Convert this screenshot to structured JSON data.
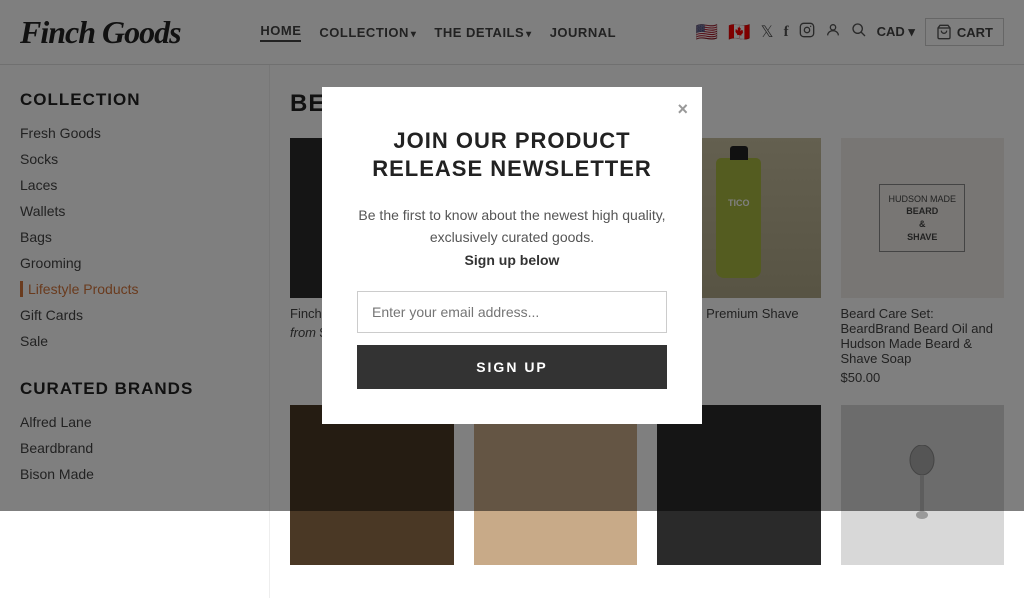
{
  "header": {
    "logo": "Finch Goods",
    "nav": [
      {
        "label": "HOME",
        "active": true,
        "hasDropdown": false
      },
      {
        "label": "COLLECTION",
        "active": false,
        "hasDropdown": true
      },
      {
        "label": "THE DETAILS",
        "active": false,
        "hasDropdown": true
      },
      {
        "label": "JOURNAL",
        "active": false,
        "hasDropdown": false
      }
    ],
    "icons": {
      "usa_flag": "🇺🇸",
      "canada_flag": "🇨🇦",
      "twitter": "𝕏",
      "facebook": "f",
      "instagram": "📷",
      "user": "👤",
      "search": "🔍"
    },
    "cad_label": "CAD ▾",
    "cart_label": "CART"
  },
  "sidebar": {
    "collection_title": "COLLECTION",
    "collection_items": [
      {
        "label": "Fresh Goods",
        "active": false
      },
      {
        "label": "Socks",
        "active": false
      },
      {
        "label": "Laces",
        "active": false
      },
      {
        "label": "Wallets",
        "active": false
      },
      {
        "label": "Bags",
        "active": false
      },
      {
        "label": "Grooming",
        "active": false
      },
      {
        "label": "Lifestyle Products",
        "active": true
      },
      {
        "label": "Gift Cards",
        "active": false
      },
      {
        "label": "Sale",
        "active": false
      }
    ],
    "brands_title": "CURATED BRANDS",
    "brands_items": [
      {
        "label": "Alfred Lane",
        "active": false
      },
      {
        "label": "Beardbrand",
        "active": false
      },
      {
        "label": "Bison Made",
        "active": false
      }
    ]
  },
  "content": {
    "page_title": "BEST SELLING GOODS",
    "products": [
      {
        "name": "Finch Goods...",
        "price": "from $10.00",
        "has_from": true,
        "image_type": "finch-card"
      },
      {
        "name": "",
        "price": "",
        "has_from": false,
        "image_type": "green-bottle"
      },
      {
        "name": "Organic Premium Shave",
        "price": "",
        "has_from": false,
        "image_type": "green-bottle"
      },
      {
        "name": "Beard Care Set: BeardBrand Beard Oil and Hudson Made Beard & Shave Soap",
        "price": "$50.00",
        "has_from": false,
        "image_type": "beard-box"
      }
    ],
    "products_row2": [
      {
        "image_type": "bottom-left"
      },
      {
        "image_type": "bottom-mid"
      },
      {
        "image_type": "bottom-mid2"
      },
      {
        "image_type": "bottom-right"
      }
    ]
  },
  "modal": {
    "title": "JOIN OUR PRODUCT RELEASE NEWSLETTER",
    "body_line1": "Be the first to know about the newest high quality,",
    "body_line2": "exclusively curated goods.",
    "body_cta": "Sign up below",
    "email_placeholder": "Enter your email address...",
    "submit_label": "SIGN UP",
    "close_label": "×"
  }
}
